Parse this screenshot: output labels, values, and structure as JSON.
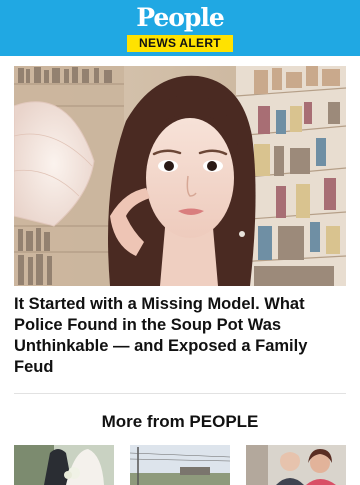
{
  "header": {
    "brand": "People",
    "badge": "NEWS ALERT",
    "colors": {
      "bar": "#20a8e3",
      "badge": "#ffe200"
    }
  },
  "hero": {
    "image": "portrait-photo-woman-bookshelves",
    "headline": "It Started with a Missing Model. What Police Found in the Soup Pot Was Unthinkable — and Exposed a Family Feud"
  },
  "more_section": {
    "title": "More from PEOPLE",
    "thumbnails": [
      {
        "image": "wedding-photo-thumbnail"
      },
      {
        "image": "street-sky-thumbnail"
      },
      {
        "image": "couple-photo-thumbnail"
      }
    ]
  }
}
